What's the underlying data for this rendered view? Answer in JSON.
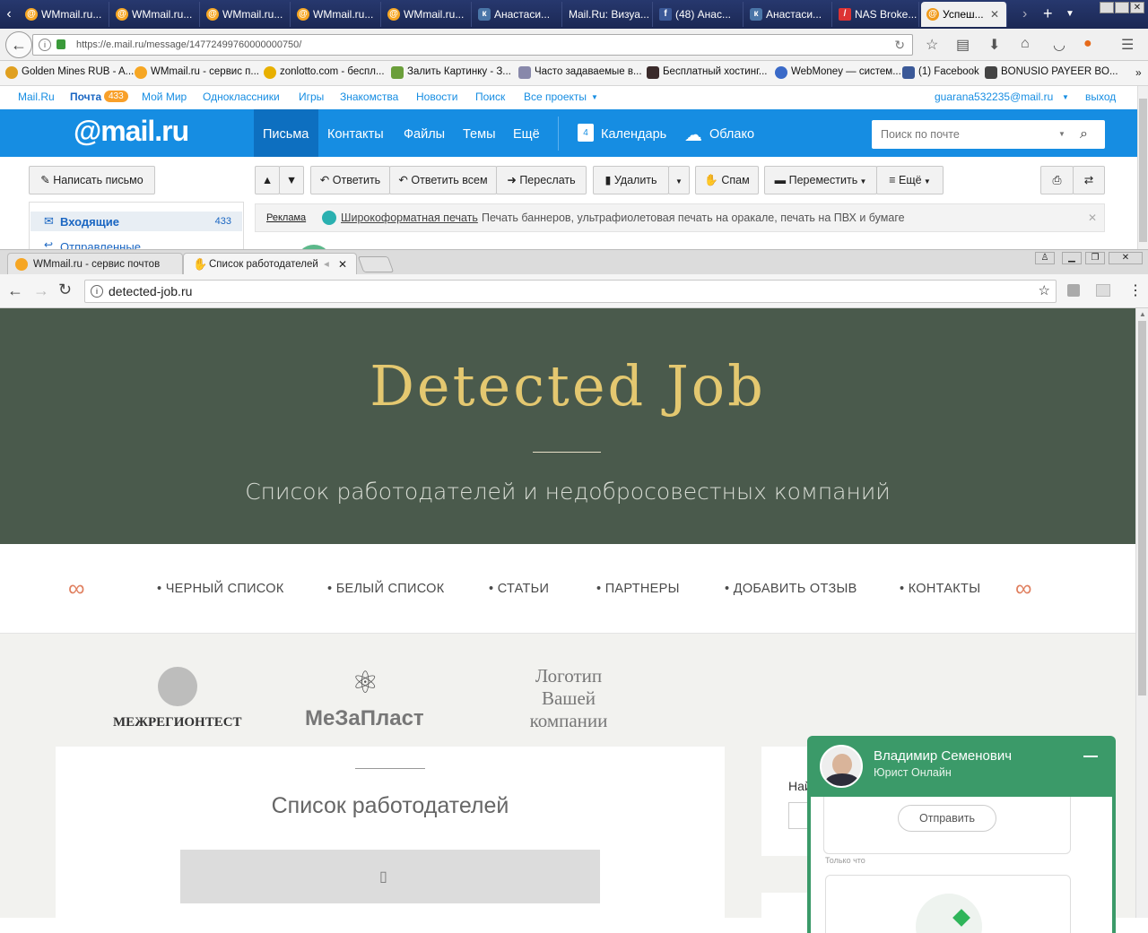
{
  "firefox": {
    "tabs": [
      {
        "label": "WMmail.ru..."
      },
      {
        "label": "WMmail.ru..."
      },
      {
        "label": "WMmail.ru..."
      },
      {
        "label": "WMmail.ru..."
      },
      {
        "label": "WMmail.ru..."
      },
      {
        "label": "Анастаси..."
      },
      {
        "label": "Mail.Ru: Визуа..."
      },
      {
        "label": "(48) Анас..."
      },
      {
        "label": "Анастаси..."
      },
      {
        "label": "NAS Broke..."
      },
      {
        "label": "Успеш..."
      }
    ],
    "url": "https://e.mail.ru/message/14772499760000000750/",
    "bookmarks": [
      {
        "label": "Golden Mines RUB - A..."
      },
      {
        "label": "WMmail.ru - сервис п..."
      },
      {
        "label": "zonlotto.com - беспл..."
      },
      {
        "label": "Залить Картинку - З..."
      },
      {
        "label": "Часто задаваемые в..."
      },
      {
        "label": "Бесплатный хостинг..."
      },
      {
        "label": "WebMoney — систем..."
      },
      {
        "label": "(1) Facebook"
      },
      {
        "label": "BONUSIO PAYEER BO..."
      }
    ]
  },
  "mailru": {
    "top_links": [
      "Mail.Ru",
      "Почта",
      "Мой Мир",
      "Одноклассники",
      "Игры",
      "Знакомства",
      "Новости",
      "Поиск",
      "Все проекты"
    ],
    "mail_badge": "433",
    "account": "guarana532235@mail.ru",
    "logout": "выход",
    "logo": "@mail.ru",
    "nav": [
      "Письма",
      "Контакты",
      "Файлы",
      "Темы",
      "Ещё"
    ],
    "calendar": "Календарь",
    "calendar_day": "4",
    "cloud": "Облако",
    "search_placeholder": "Поиск по почте",
    "compose": "Написать письмо",
    "toolbar": {
      "reply": "Ответить",
      "reply_all": "Ответить всем",
      "forward": "Переслать",
      "delete": "Удалить",
      "spam": "Спам",
      "move": "Переместить",
      "more": "Ещё"
    },
    "folders": [
      {
        "label": "Входящие",
        "count": "433"
      },
      {
        "label": "Отправленные"
      }
    ],
    "ad": {
      "tag": "Реклама",
      "link": "Широкоформатная печать",
      "text": "Печать баннеров, ультрафиолетовая печать на оракале, печать на ПВХ и бумаге"
    }
  },
  "chrome": {
    "tabs": [
      {
        "label": "WMmail.ru - сервис почтов"
      },
      {
        "label": "Список работодателей"
      }
    ],
    "url": "detected-job.ru"
  },
  "site": {
    "title": "Detected Job",
    "subtitle": "Список работодателей и недобросовестных компаний",
    "menu": [
      "• ЧЕРНЫЙ СПИСОК",
      "• БЕЛЫЙ СПИСОК",
      "• СТАТЬИ",
      "• ПАРТНЕРЫ",
      "• ДОБАВИТЬ ОТЗЫВ",
      "• КОНТАКТЫ"
    ],
    "partners": [
      "МЕЖРЕГИОНТЕСТ",
      "МеЗаПласт",
      "Логотип Вашей компании"
    ],
    "section_title": "Список работодателей",
    "side_label": "Най",
    "chat": {
      "name": "Владимир Семенович",
      "role": "Юрист Онлайн",
      "send": "Отправить",
      "time": "Только что"
    }
  }
}
